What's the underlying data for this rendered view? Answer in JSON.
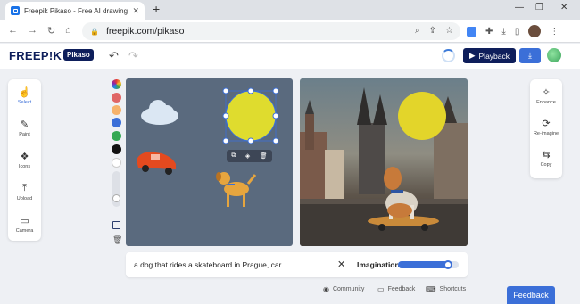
{
  "browser": {
    "tab_title": "Freepik Pikaso - Free AI drawing",
    "tab_close": "✕",
    "new_tab": "+",
    "url": "freepik.com/pikaso",
    "back": "←",
    "forward": "→",
    "reload": "↻",
    "home": "⌂",
    "minimize": "—",
    "maximize": "❐",
    "close": "✕"
  },
  "app": {
    "logo": "FREEP!K",
    "product": "Pikaso",
    "playback_label": "Playback",
    "playback_icon": "▶",
    "download_icon": "⤓",
    "undo": "↶",
    "redo": "↷"
  },
  "left_tools": [
    {
      "label": "Select",
      "icon": "☝",
      "active": true
    },
    {
      "label": "Paint",
      "icon": "✎"
    },
    {
      "label": "Icons",
      "icon": "❖"
    },
    {
      "label": "Upload",
      "icon": "⤒"
    },
    {
      "label": "Camera",
      "icon": "▭"
    }
  ],
  "palette": {
    "colors": [
      "#e06666",
      "#f6b26b",
      "#3b6fd8",
      "#34a853",
      "#111111",
      "#ffffff"
    ],
    "size_level": 0.75
  },
  "shape_toolbar": [
    "⧉",
    "◈",
    "🗑"
  ],
  "right_tools": [
    {
      "label": "Enhance",
      "icon": "✧"
    },
    {
      "label": "Re-imagine",
      "icon": "⟳"
    },
    {
      "label": "Copy",
      "icon": "⇆"
    }
  ],
  "prompt": {
    "text": "a dog that rides a skateboard in Prague, car",
    "clear": "✕",
    "imagination_label": "Imagination",
    "imagination_value": 0.82
  },
  "footer": {
    "community": "Community",
    "feedback": "Feedback",
    "shortcuts": "Shortcuts",
    "feedback_button": "Feedback"
  },
  "colors": {
    "brand_navy": "#0e1e5b",
    "accent_blue": "#3b6fd8",
    "canvas_bg": "#5a6a7e",
    "sun_yellow": "#dfdc2e"
  }
}
